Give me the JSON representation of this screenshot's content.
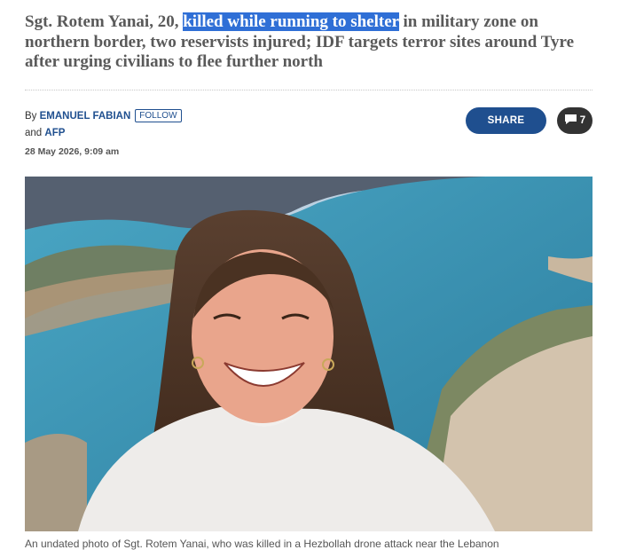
{
  "article": {
    "headline_before": "Sgt. Rotem Yanai, 20, ",
    "headline_highlight": "killed while running to shelter",
    "headline_after": " in military zone on northern border, two reservists injured; IDF targets terror sites around Tyre after urging civilians to flee further north",
    "byline_prefix": "By",
    "author1": "EMANUEL FABIAN",
    "follow_label": "FOLLOW",
    "and_label": "and",
    "author2": "AFP",
    "date": "28 May 2026, 9:09 am",
    "share_label": "SHARE",
    "comment_count": "7",
    "caption": "An undated photo of Sgt. Rotem Yanai, who was killed in a Hezbollah drone attack near the Lebanon"
  },
  "icons": {
    "share": "share-icon",
    "comment": "comment-bubble-icon"
  },
  "colors": {
    "brand_blue": "#1f4f8f",
    "highlight": "#2f6fd6",
    "comment_button": "#333333"
  }
}
